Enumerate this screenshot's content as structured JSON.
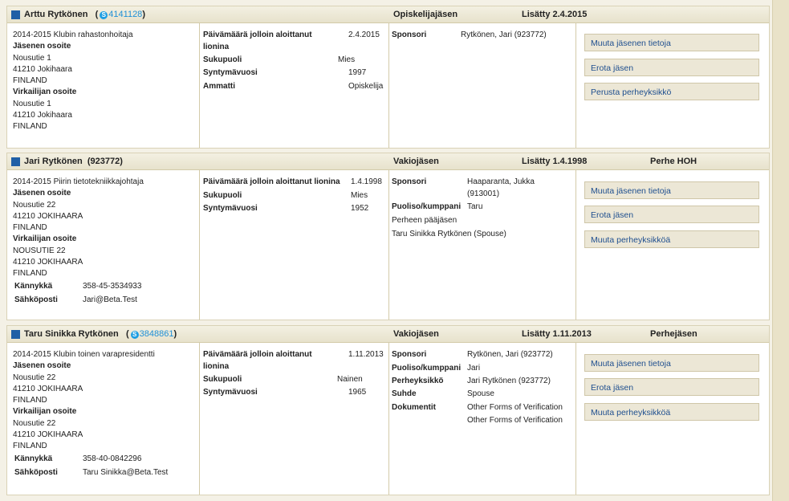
{
  "members": [
    {
      "name": "Arttu  Rytkönen",
      "id_prefix": "(",
      "skype_id": "4141128",
      "id_suffix": ")",
      "type": "Opiskelijajäsen",
      "added": "Lisätty 2.4.2015",
      "family": "",
      "position": "2014-2015 Klubin rahastonhoitaja",
      "member_address_label": "Jäsenen osoite",
      "member_address": [
        "Nousutie 1",
        "41210 Jokihaara",
        "FINLAND"
      ],
      "official_address_label": "Virkailijan osoite",
      "official_address": [
        "Nousutie 1",
        "41210 Jokihaara",
        "FINLAND"
      ],
      "contacts": [],
      "start_label": [
        "Päivämäärä jolloin aloittanut",
        "lionina"
      ],
      "start_value": "2.4.2015",
      "details": [
        {
          "label": "Sukupuoli",
          "value": "Mies"
        },
        {
          "label": "Syntymävuosi",
          "value": "1997"
        },
        {
          "label": "Ammatti",
          "value": "Opiskelija"
        }
      ],
      "relations": [
        {
          "label": "Sponsori",
          "value": "Rytkönen, Jari   (923772)"
        }
      ],
      "buttons": [
        "Muuta jäsenen tietoja",
        "Erota jäsen",
        "Perusta perheyksikkö"
      ]
    },
    {
      "name": "Jari  Rytkönen",
      "id_prefix": "  (923772)",
      "skype_id": "",
      "id_suffix": "",
      "type": "Vakiojäsen",
      "added": "Lisätty 1.4.1998",
      "family": "Perhe HOH",
      "position": "2014-2015 Piirin tietotekniikkajohtaja",
      "member_address_label": "Jäsenen osoite",
      "member_address": [
        "Nousutie 22",
        "41210 JOKIHAARA",
        "FINLAND"
      ],
      "official_address_label": "Virkailijan osoite",
      "official_address": [
        "NOUSUTIE 22",
        "41210 JOKIHAARA",
        "FINLAND"
      ],
      "contacts": [
        {
          "label": "Kännykkä",
          "value": "358-45-3534933"
        },
        {
          "label": "Sähköposti",
          "value": "Jari@Beta.Test"
        }
      ],
      "start_label": [
        "Päivämäärä jolloin aloittanut lionina"
      ],
      "start_value": "1.4.1998",
      "details": [
        {
          "label": "Sukupuoli",
          "value": "Mies"
        },
        {
          "label": "Syntymävuosi",
          "value": "1952"
        }
      ],
      "relations": [
        {
          "label": "Sponsori",
          "value": "Haaparanta, Jukka",
          "value2": "(913001)"
        },
        {
          "label": "Puoliso/kumppani",
          "value": "Taru"
        }
      ],
      "family_head_label": "Perheen pääjäsen",
      "family_members": [
        "Taru Sinikka Rytkönen (Spouse)"
      ],
      "buttons": [
        "Muuta jäsenen tietoja",
        "Erota jäsen",
        "Muuta perheyksikköä"
      ]
    },
    {
      "name": "Taru Sinikka  Rytkönen",
      "id_prefix": "(",
      "skype_id": "3848861",
      "id_suffix": ")",
      "type": "Vakiojäsen",
      "added": "Lisätty 1.11.2013",
      "family": "Perhejäsen",
      "position": "2014-2015 Klubin toinen varapresidentti",
      "member_address_label": "Jäsenen osoite",
      "member_address": [
        "Nousutie 22",
        "41210 JOKIHAARA",
        "FINLAND"
      ],
      "official_address_label": "Virkailijan osoite",
      "official_address": [
        "Nousutie 22",
        "41210 JOKIHAARA",
        "FINLAND"
      ],
      "contacts": [
        {
          "label": "Kännykkä",
          "value": "358-40-0842296"
        },
        {
          "label": "Sähköposti",
          "value": "Taru Sinikka@Beta.Test"
        }
      ],
      "start_label": [
        "Päivämäärä jolloin aloittanut",
        "lionina"
      ],
      "start_value": "1.11.2013",
      "details": [
        {
          "label": "Sukupuoli",
          "value": "Nainen"
        },
        {
          "label": "Syntymävuosi",
          "value": "1965"
        }
      ],
      "relations": [
        {
          "label": "Sponsori",
          "value": "Rytkönen, Jari   (923772)"
        },
        {
          "label": "Puoliso/kumppani",
          "value": "Jari"
        },
        {
          "label": "Perheyksikkö",
          "value": "Jari Rytkönen (923772)"
        },
        {
          "label": "Suhde",
          "value": "Spouse"
        },
        {
          "label": "Dokumentit",
          "value": "Other Forms of Verification",
          "value2": "Other Forms of Verification"
        }
      ],
      "buttons": [
        "Muuta jäsenen tietoja",
        "Erota jäsen",
        "Muuta perheyksikköä"
      ]
    }
  ]
}
